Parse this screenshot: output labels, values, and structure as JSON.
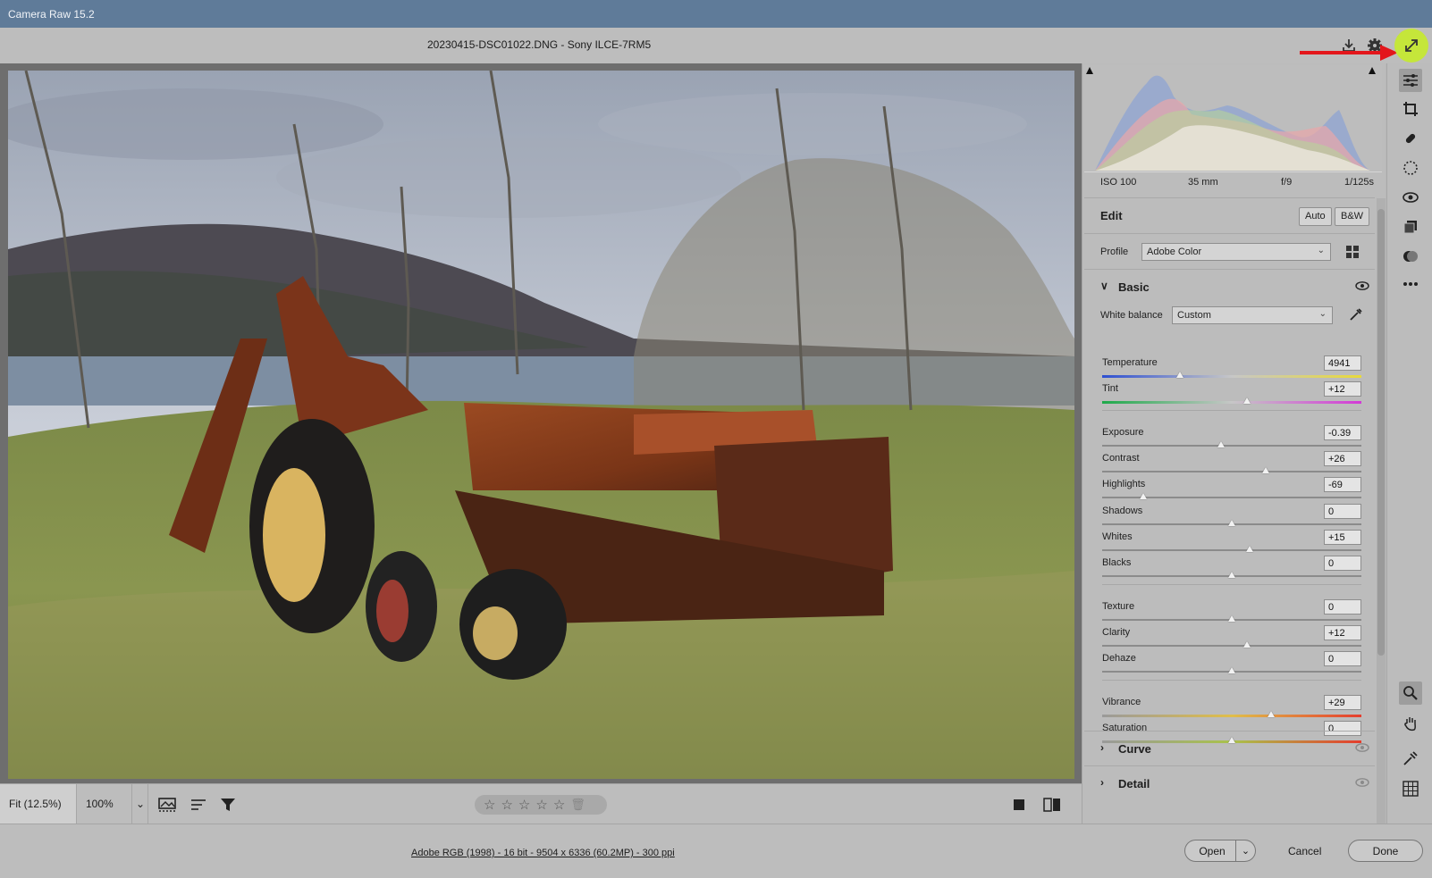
{
  "window": {
    "title": "Camera Raw 15.2"
  },
  "header": {
    "filename": "20230415-DSC01022.DNG  -  Sony ILCE-7RM5"
  },
  "exif": {
    "iso": "ISO 100",
    "focal": "35 mm",
    "aperture": "f/9",
    "shutter": "1/125s"
  },
  "edit": {
    "title": "Edit",
    "auto_label": "Auto",
    "bw_label": "B&W"
  },
  "profile": {
    "label": "Profile",
    "value": "Adobe Color"
  },
  "basic": {
    "title": "Basic",
    "white_balance_label": "White balance",
    "white_balance_value": "Custom",
    "sliders": [
      {
        "name": "Temperature",
        "value": "4941",
        "position": 0.3,
        "gradient": "temp"
      },
      {
        "name": "Tint",
        "value": "+12",
        "position": 0.56,
        "gradient": "tint"
      },
      {
        "name": "Exposure",
        "value": "-0.39",
        "position": 0.46
      },
      {
        "name": "Contrast",
        "value": "+26",
        "position": 0.63
      },
      {
        "name": "Highlights",
        "value": "-69",
        "position": 0.16
      },
      {
        "name": "Shadows",
        "value": "0",
        "position": 0.5
      },
      {
        "name": "Whites",
        "value": "+15",
        "position": 0.57
      },
      {
        "name": "Blacks",
        "value": "0",
        "position": 0.5
      },
      {
        "name": "Texture",
        "value": "0",
        "position": 0.5
      },
      {
        "name": "Clarity",
        "value": "+12",
        "position": 0.56
      },
      {
        "name": "Dehaze",
        "value": "0",
        "position": 0.5
      },
      {
        "name": "Vibrance",
        "value": "+29",
        "position": 0.65,
        "gradient": "vib"
      },
      {
        "name": "Saturation",
        "value": "0",
        "position": 0.5,
        "gradient": "sat"
      }
    ]
  },
  "sections": {
    "curve": "Curve",
    "detail": "Detail"
  },
  "bottombar": {
    "zoom_fit": "Fit (12.5%)",
    "zoom_100": "100%"
  },
  "footer": {
    "info": "Adobe RGB (1998) - 16 bit - 9504 x 6336 (60.2MP) - 300 ppi",
    "open": "Open",
    "cancel": "Cancel",
    "done": "Done"
  },
  "colors": {
    "titlebar": "#5f7b99",
    "highlight": "#c5e63a",
    "arrow": "#e3161b"
  },
  "icons": [
    "save-icon",
    "gear-icon",
    "fullscreen-icon",
    "edit-sliders-icon",
    "crop-icon",
    "healing-brush-icon",
    "mask-icon",
    "red-eye-icon",
    "snapshots-icon",
    "presets-icon",
    "more-icon",
    "zoom-icon",
    "hand-icon",
    "color-sampler-icon",
    "grid-icon"
  ]
}
